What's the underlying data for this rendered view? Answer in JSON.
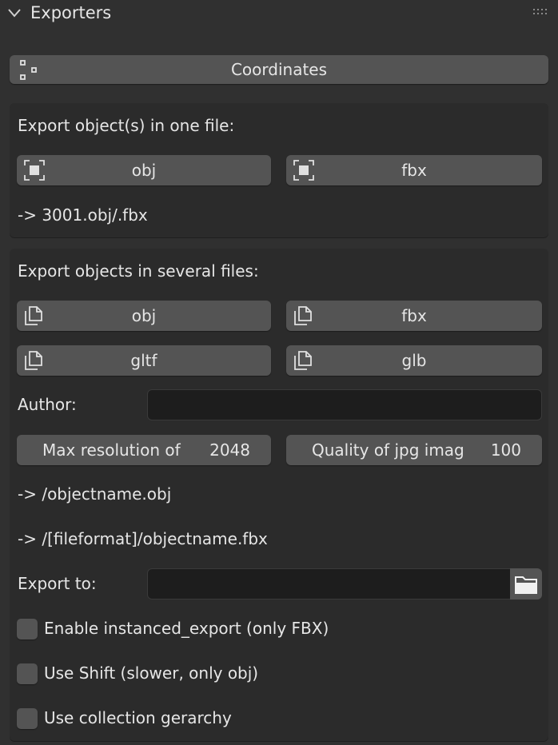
{
  "panel": {
    "title": "Exporters"
  },
  "coordinates_button": "Coordinates",
  "single_file": {
    "heading": "Export object(s) in one file:",
    "obj_label": "obj",
    "fbx_label": "fbx",
    "hint": "-> 3001.obj/.fbx"
  },
  "several_files": {
    "heading": "Export objects in several files:",
    "obj_label": "obj",
    "fbx_label": "fbx",
    "gltf_label": "gltf",
    "glb_label": "glb",
    "author_label": "Author:",
    "author_value": "",
    "max_res_label": "Max resolution of",
    "max_res_value": "2048",
    "jpg_quality_label": "Quality of jpg imag",
    "jpg_quality_value": "100",
    "hint_obj": "-> /objectname.obj",
    "hint_fbx": "-> /[fileformat]/objectname.fbx",
    "export_to_label": "Export to:",
    "export_to_value": "",
    "enable_instanced_label": "Enable instanced_export (only FBX)",
    "use_shift_label": "Use Shift (slower, only obj)",
    "use_collection_label": "Use collection gerarchy"
  },
  "icons": {
    "panel_toggle": "chevron-down-icon",
    "coordinates": "nodes-icon",
    "single_export": "select-box-icon",
    "multi_export": "duplicate-icon",
    "folder": "folder-icon",
    "grip": "drag-grip-icon"
  }
}
